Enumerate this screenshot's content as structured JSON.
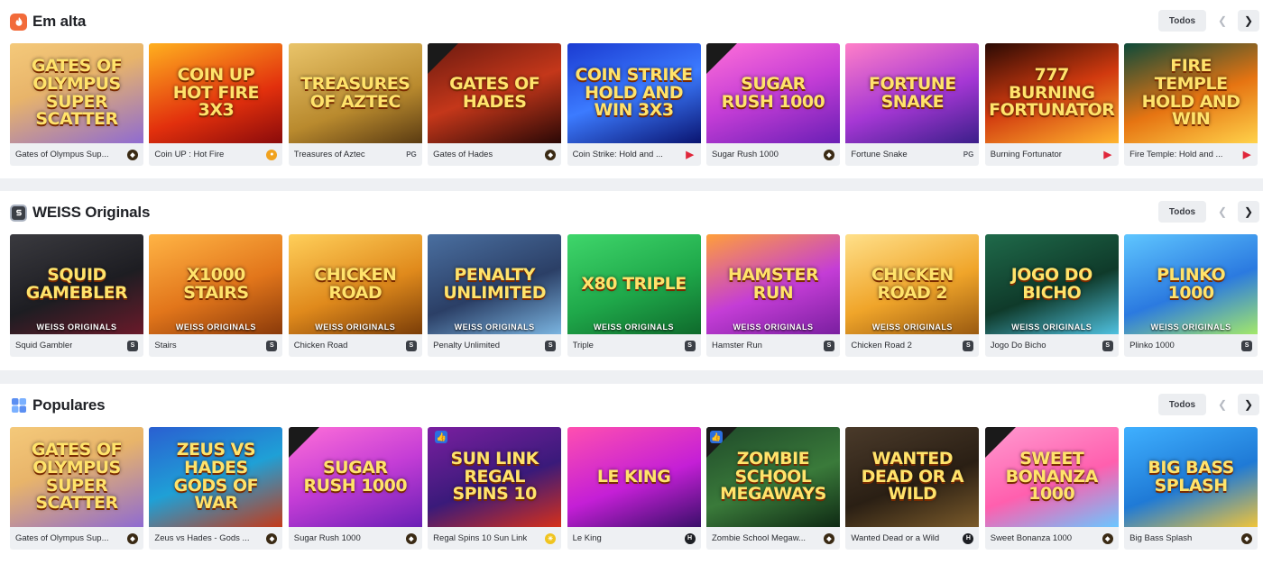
{
  "sections": [
    {
      "title": "Em alta",
      "icon": "fire-icon",
      "todos": "Todos",
      "cards": [
        {
          "name": "Gates of Olympus Sup...",
          "art": "GATES OF OLYMPUS SUPER SCATTER",
          "provider": "pragmatic",
          "bg": "linear-gradient(160deg,#f4c97a,#e8b46a 40%,#8f6bd1)"
        },
        {
          "name": "Coin UP : Hot Fire",
          "art": "COIN UP HOT FIRE 3X3",
          "provider": "coin",
          "bg": "linear-gradient(160deg,#ffb01f,#e2300d 60%,#8a0b0b)"
        },
        {
          "name": "Treasures of Aztec",
          "art": "TREASURES OF AZTEC",
          "provider": "PG",
          "bg": "linear-gradient(160deg,#e9c46a,#b98a2e 60%,#5a3b12)"
        },
        {
          "name": "Gates of Hades",
          "art": "GATES OF HADES",
          "provider": "pragmatic",
          "bg": "linear-gradient(160deg,#6b1a10,#c4371a 50%,#2a0806)",
          "drops": true
        },
        {
          "name": "Coin Strike: Hold and ...",
          "art": "COIN STRIKE HOLD AND WIN 3X3",
          "provider": "play",
          "bg": "linear-gradient(160deg,#1b3bd1,#3c7bff 50%,#0a1470)"
        },
        {
          "name": "Sugar Rush 1000",
          "art": "SUGAR RUSH 1000",
          "provider": "pragmatic",
          "bg": "linear-gradient(160deg,#ff6fd8,#c43dd6 50%,#6a1fb5)",
          "drops": true
        },
        {
          "name": "Fortune Snake",
          "art": "FORTUNE SNAKE",
          "provider": "PG",
          "bg": "linear-gradient(160deg,#ff7fc8,#a537d4 55%,#3b1f8a)"
        },
        {
          "name": "Burning Fortunator",
          "art": "777 BURNING FORTUNATOR",
          "provider": "play",
          "bg": "linear-gradient(160deg,#2a0a04,#d13a0f 50%,#ffb52e)"
        },
        {
          "name": "Fire Temple: Hold and ...",
          "art": "FIRE TEMPLE HOLD AND WIN",
          "provider": "play",
          "bg": "linear-gradient(160deg,#0d4a3a,#e67412 55%,#ffd24a)"
        }
      ]
    },
    {
      "title": "WEISS Originals",
      "icon": "weiss-s-icon",
      "todos": "Todos",
      "cards": [
        {
          "name": "Squid Gambler",
          "art": "SQUID GAMEBLER",
          "provider": "weiss",
          "bg": "linear-gradient(160deg,#3a3a3f,#1d1d22 55%,#6a1a2a)",
          "wo": "WEISS ORIGINALS"
        },
        {
          "name": "Stairs",
          "art": "X1000 STAIRS",
          "provider": "weiss",
          "bg": "linear-gradient(160deg,#ffb445,#e2761b 55%,#8a3a0a)",
          "wo": "WEISS ORIGINALS"
        },
        {
          "name": "Chicken Road",
          "art": "CHICKEN ROAD",
          "provider": "weiss",
          "bg": "linear-gradient(160deg,#ffcf5a,#e08a1c 55%,#7a3d08)",
          "wo": "WEISS ORIGINALS"
        },
        {
          "name": "Penalty Unlimited",
          "art": "PENALTY UNLIMITED",
          "provider": "weiss",
          "bg": "linear-gradient(160deg,#4a6fa0,#2b3f66 55%,#7ab4e0)",
          "wo": "WEISS ORIGINALS"
        },
        {
          "name": "Triple",
          "art": "X80 TRIPLE",
          "provider": "weiss",
          "bg": "linear-gradient(160deg,#3fd66b,#1fa84a 55%,#0f6a2c)",
          "wo": "WEISS ORIGINALS"
        },
        {
          "name": "Hamster Run",
          "art": "HAMSTER RUN",
          "provider": "weiss",
          "bg": "linear-gradient(160deg,#ff9f3a,#c43dd6 55%,#7a1fa0)",
          "wo": "WEISS ORIGINALS"
        },
        {
          "name": "Chicken Road 2",
          "art": "CHICKEN ROAD 2",
          "provider": "weiss",
          "bg": "linear-gradient(160deg,#ffe08a,#f0a52a 55%,#9a5a10)",
          "wo": "WEISS ORIGINALS"
        },
        {
          "name": "Jogo Do Bicho",
          "art": "JOGO DO BICHO",
          "provider": "weiss",
          "bg": "linear-gradient(160deg,#1f6a4a,#0f3a2a 55%,#4fc1e0)",
          "wo": "WEISS ORIGINALS"
        },
        {
          "name": "Plinko 1000",
          "art": "PLINKO 1000",
          "provider": "weiss",
          "bg": "linear-gradient(160deg,#5fc6ff,#2b7ae0 55%,#a3e86a)",
          "wo": "WEISS ORIGINALS"
        }
      ]
    },
    {
      "title": "Populares",
      "icon": "grid-icon",
      "todos": "Todos",
      "cards": [
        {
          "name": "Gates of Olympus Sup...",
          "art": "GATES OF OLYMPUS SUPER SCATTER",
          "provider": "pragmatic",
          "bg": "linear-gradient(160deg,#f4c97a,#e8b46a 40%,#8f6bd1)"
        },
        {
          "name": "Zeus vs Hades - Gods ...",
          "art": "ZEUS VS HADES GODS OF WAR",
          "provider": "pragmatic",
          "bg": "linear-gradient(160deg,#2a5fd1,#1fa0d6 50%,#c43a1a)"
        },
        {
          "name": "Sugar Rush 1000",
          "art": "SUGAR RUSH 1000",
          "provider": "pragmatic",
          "bg": "linear-gradient(160deg,#ff6fd8,#c43dd6 50%,#6a1fb5)",
          "drops": true
        },
        {
          "name": "Regal Spins 10 Sun Link",
          "art": "SUN LINK REGAL SPINS 10",
          "provider": "sun",
          "bg": "linear-gradient(160deg,#7a1fa0,#3a1a7a 55%,#d6301a)",
          "like": true
        },
        {
          "name": "Le King",
          "art": "LE KING",
          "provider": "hacksaw",
          "bg": "linear-gradient(160deg,#ff4fb0,#c41fd6 55%,#3a0f6a)"
        },
        {
          "name": "Zombie School Megaw...",
          "art": "ZOMBIE SCHOOL MEGAWAYS",
          "provider": "pragmatic",
          "bg": "linear-gradient(160deg,#1f4a2a,#3a7a3a 55%,#0f2a14)",
          "drops": true,
          "like": true
        },
        {
          "name": "Wanted Dead or a Wild",
          "art": "WANTED DEAD OR A WILD",
          "provider": "hacksaw",
          "bg": "linear-gradient(160deg,#4a3a2a,#2a1f14 55%,#7a5a2a)"
        },
        {
          "name": "Sweet Bonanza 1000",
          "art": "SWEET BONANZA 1000",
          "provider": "pragmatic",
          "bg": "linear-gradient(160deg,#ff9ad0,#ff5fae 55%,#6ac6ff)",
          "drops": true
        },
        {
          "name": "Big Bass Splash",
          "art": "BIG BASS SPLASH",
          "provider": "pragmatic",
          "bg": "linear-gradient(160deg,#3fb0ff,#1f7ad6 55%,#f0c43a)"
        }
      ]
    }
  ],
  "colors": {
    "pragmatic": "#3a2a14",
    "coin": "#f0a21f",
    "play": "#e0263a",
    "weiss": "#3b3f46",
    "sun": "#f0c41f",
    "hacksaw": "#1d1f24"
  }
}
